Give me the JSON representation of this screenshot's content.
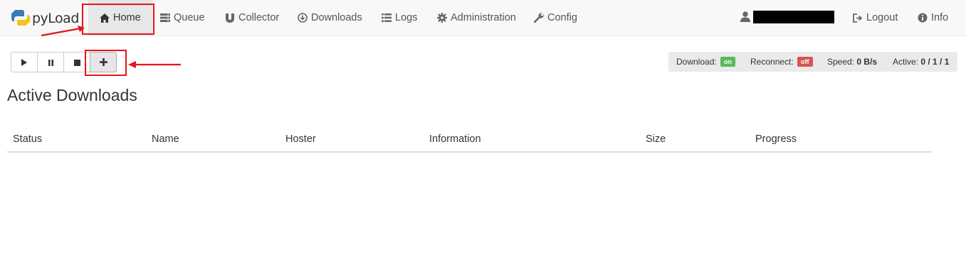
{
  "app": {
    "brand": "pyLoad"
  },
  "nav": {
    "home": "Home",
    "queue": "Queue",
    "collector": "Collector",
    "downloads": "Downloads",
    "logs": "Logs",
    "administration": "Administration",
    "config": "Config",
    "logout": "Logout",
    "info": "Info"
  },
  "status": {
    "download_label": "Download:",
    "download_state": "on",
    "reconnect_label": "Reconnect:",
    "reconnect_state": "off",
    "speed_label": "Speed:",
    "speed_value": "0 B/s",
    "active_label": "Active:",
    "active_value": "0 / 1 / 1"
  },
  "main": {
    "title": "Active Downloads",
    "columns": [
      "Status",
      "Name",
      "Hoster",
      "Information",
      "Size",
      "Progress"
    ]
  },
  "colors": {
    "annotation": "#e8131c",
    "on": "#5cb85c",
    "off": "#d9534f"
  }
}
